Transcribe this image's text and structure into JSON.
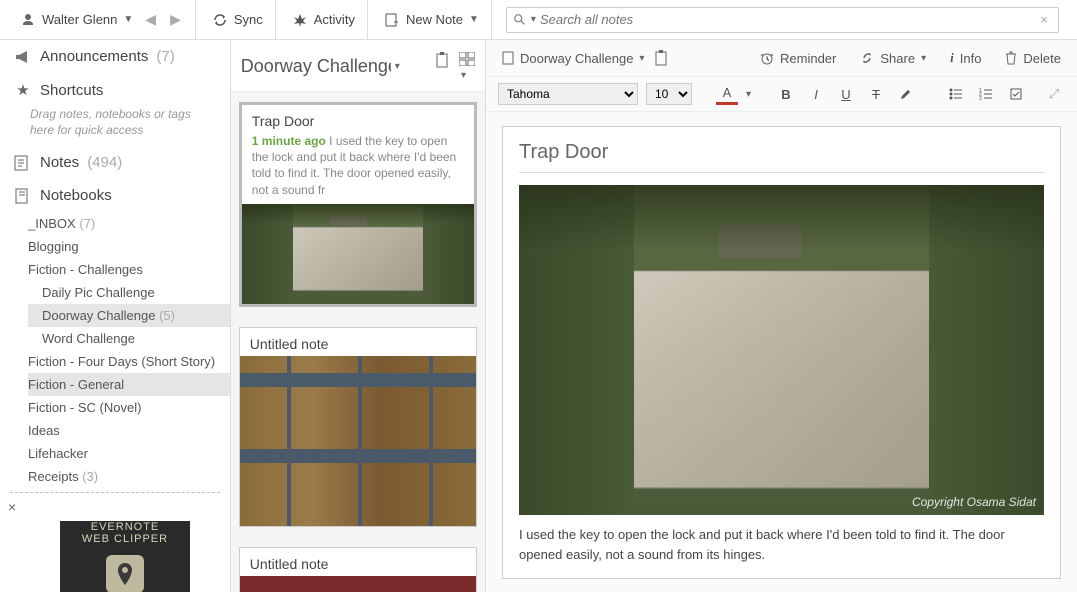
{
  "topbar": {
    "user": "Walter Glenn",
    "sync": "Sync",
    "activity": "Activity",
    "new_note": "New Note",
    "search_placeholder": "Search all notes"
  },
  "sidebar": {
    "announcements": {
      "label": "Announcements",
      "count": "(7)"
    },
    "shortcuts": {
      "label": "Shortcuts",
      "hint": "Drag notes, notebooks or tags here for quick access"
    },
    "notes": {
      "label": "Notes",
      "count": "(494)"
    },
    "notebooks": {
      "label": "Notebooks"
    },
    "items": [
      {
        "label": "_INBOX",
        "count": "(7)"
      },
      {
        "label": "Blogging",
        "count": ""
      },
      {
        "label": "Fiction - Challenges",
        "count": ""
      },
      {
        "label": "Daily Pic Challenge",
        "count": "",
        "sub": true
      },
      {
        "label": "Doorway Challenge",
        "count": "(5)",
        "sub": true,
        "selected": true
      },
      {
        "label": "Word Challenge",
        "count": "",
        "sub": true
      },
      {
        "label": "Fiction - Four Days (Short Story)",
        "count": ""
      },
      {
        "label": "Fiction - General",
        "count": "",
        "selected": true
      },
      {
        "label": "Fiction - SC (Novel)",
        "count": ""
      },
      {
        "label": "Ideas",
        "count": ""
      },
      {
        "label": "Lifehacker",
        "count": ""
      },
      {
        "label": "Receipts",
        "count": "(3)"
      }
    ],
    "clipper": {
      "line1": "EVERNOTE",
      "line2": "WEB CLIPPER"
    }
  },
  "notelist": {
    "header": "Doorway Challenge",
    "cards": [
      {
        "title": "Trap Door",
        "ago": "1 minute ago",
        "snippet": "I used the key to open the lock and put it back where I'd been told to find it. The door opened easily, not a sound fr"
      },
      {
        "title": "Untitled note"
      },
      {
        "title": "Untitled note"
      }
    ]
  },
  "editor": {
    "notebook": "Doorway Challenge",
    "reminder": "Reminder",
    "share": "Share",
    "info": "Info",
    "delete": "Delete",
    "font": "Tahoma",
    "size": "10",
    "title": "Trap Door",
    "body": "I used the key to open the lock and put it back where I'd been told to find it. The door opened easily, not a sound from its hinges.",
    "copyright": "Copyright Osama Sidat"
  }
}
